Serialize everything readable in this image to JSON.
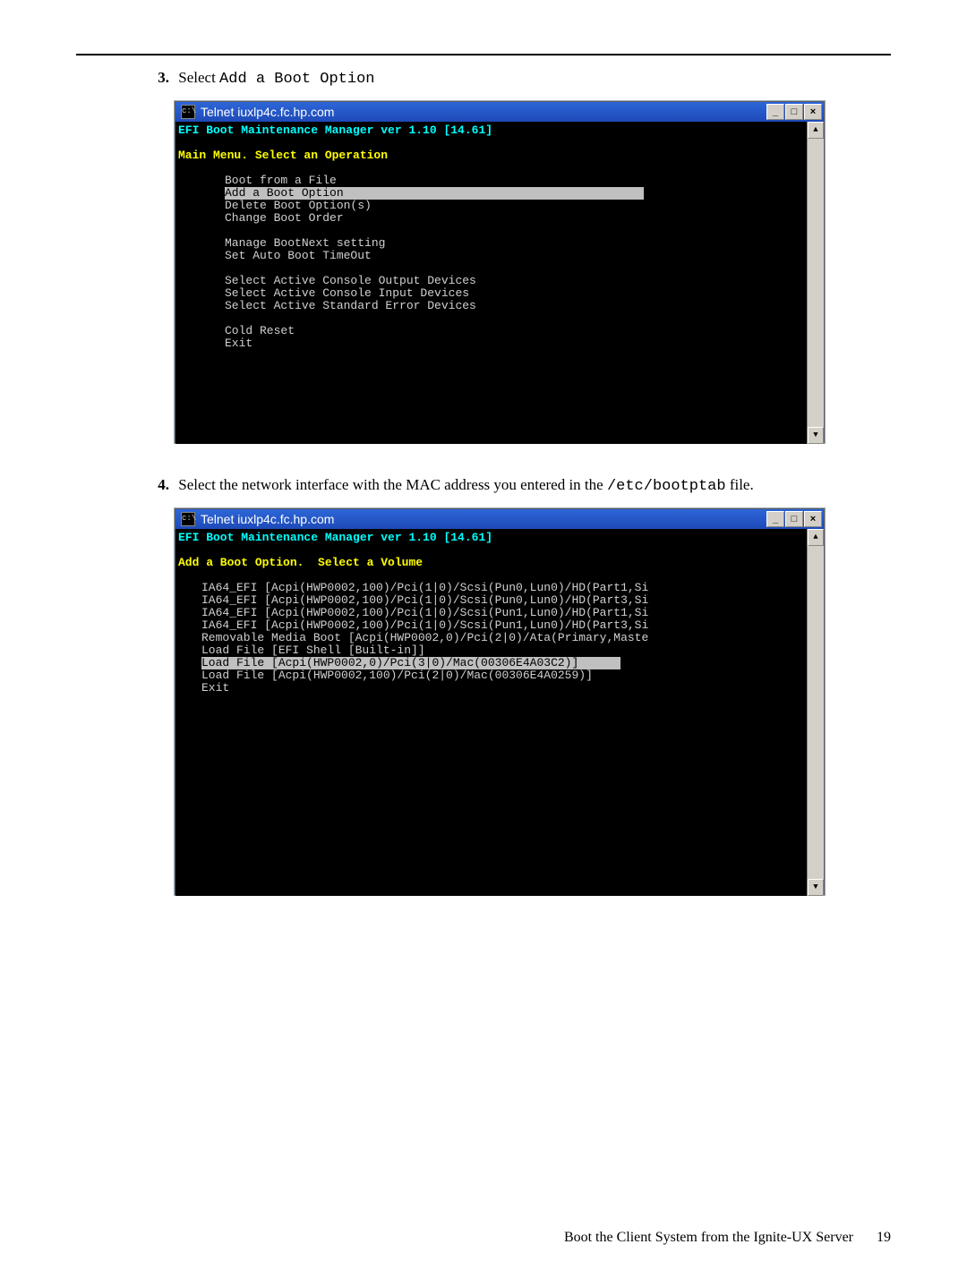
{
  "step3": {
    "num": "3.",
    "textA": "Select ",
    "code": "Add a Boot Option"
  },
  "step4": {
    "num": "4.",
    "textA": "Select the network interface with the MAC address you entered in the ",
    "code": "/etc/bootptab",
    "textB": " file."
  },
  "win1": {
    "title": "Telnet iuxlp4c.fc.hp.com",
    "icon": "c:\\",
    "header": "EFI Boot Maintenance Manager ver 1.10 [14.61]",
    "sub": "Main Menu. Select an Operation",
    "items": [
      "Boot from a File",
      "Add a Boot Option",
      "Delete Boot Option(s)",
      "Change Boot Order",
      "",
      "Manage BootNext setting",
      "Set Auto Boot TimeOut",
      "",
      "Select Active Console Output Devices",
      "Select Active Console Input Devices",
      "Select Active Standard Error Devices",
      "",
      "Cold Reset",
      "Exit"
    ],
    "selectedIndex": 1
  },
  "win2": {
    "title": "Telnet iuxlp4c.fc.hp.com",
    "icon": "c:\\",
    "header": "EFI Boot Maintenance Manager ver 1.10 [14.61]",
    "sub": "Add a Boot Option.  Select a Volume",
    "items": [
      "IA64_EFI [Acpi(HWP0002,100)/Pci(1|0)/Scsi(Pun0,Lun0)/HD(Part1,Si",
      "IA64_EFI [Acpi(HWP0002,100)/Pci(1|0)/Scsi(Pun0,Lun0)/HD(Part3,Si",
      "IA64_EFI [Acpi(HWP0002,100)/Pci(1|0)/Scsi(Pun1,Lun0)/HD(Part1,Si",
      "IA64_EFI [Acpi(HWP0002,100)/Pci(1|0)/Scsi(Pun1,Lun0)/HD(Part3,Si",
      "Removable Media Boot [Acpi(HWP0002,0)/Pci(2|0)/Ata(Primary,Maste",
      "Load File [EFI Shell [Built-in]]",
      "Load File [Acpi(HWP0002,0)/Pci(3|0)/Mac(00306E4A03C2)]",
      "Load File [Acpi(HWP0002,100)/Pci(2|0)/Mac(00306E4A0259)]",
      "Exit"
    ],
    "selectedIndex": 6
  },
  "footer": {
    "title": "Boot the Client System from the Ignite-UX Server",
    "page": "19"
  }
}
